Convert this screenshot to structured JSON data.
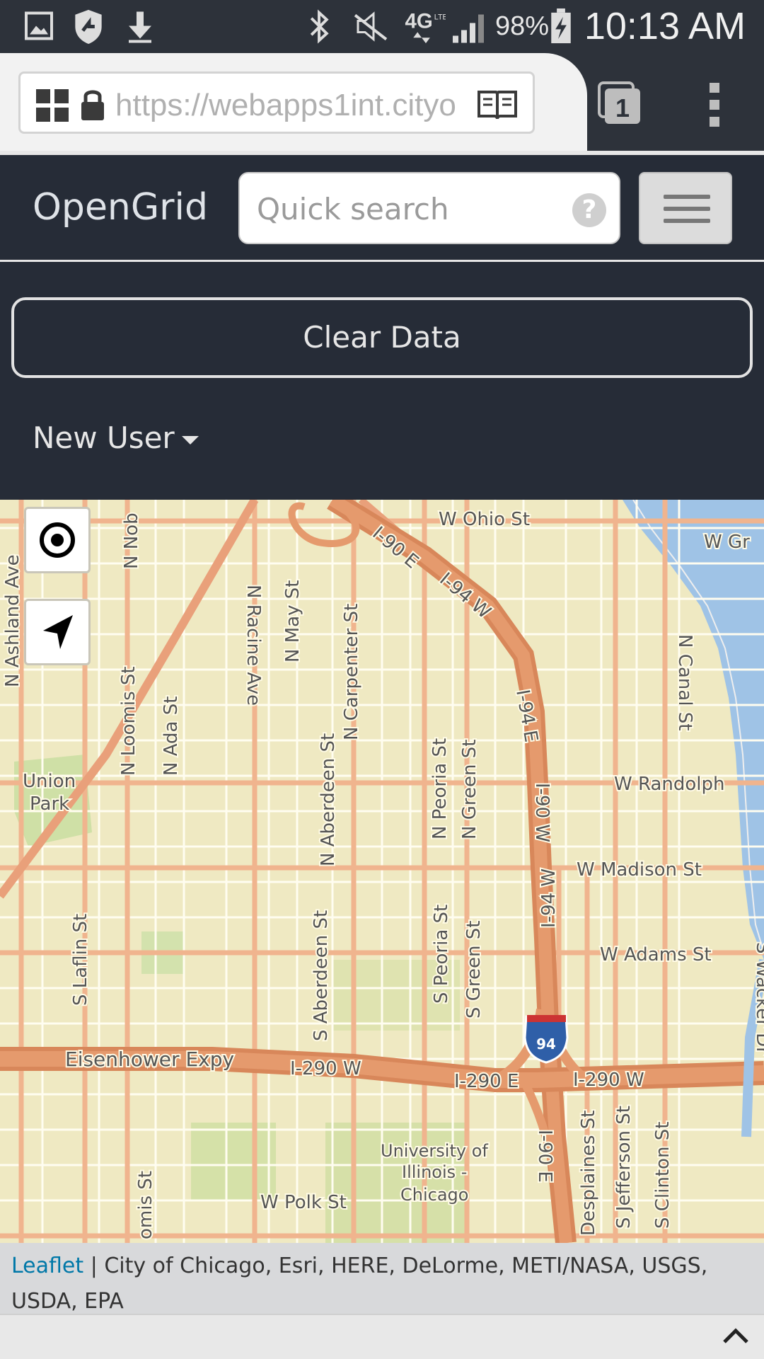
{
  "status_bar": {
    "battery": "98%",
    "time": "10:13 AM",
    "network": "4G"
  },
  "browser": {
    "url": "https://webapps1int.cityo",
    "tab_count": "1"
  },
  "app": {
    "brand": "OpenGrid",
    "search_placeholder": "Quick search",
    "help_glyph": "?",
    "clear_button": "Clear Data",
    "user_menu": "New User"
  },
  "map": {
    "streets": {
      "ohio": "W Ohio St",
      "gr": "W Gr",
      "randolph": "W Randolph",
      "madison": "W Madison St",
      "adams": "W Adams St",
      "polk": "W Polk St",
      "ashland": "N Ashland Ave",
      "nob": "N Nob",
      "may": "N May St",
      "carpenter": "N Carpenter St",
      "racine": "N Racine Ave",
      "loomis": "N Loomis St",
      "ada": "N Ada St",
      "n_aberdeen": "N Aberdeen St",
      "n_peoria": "N Peoria St",
      "n_green": "N Green St",
      "s_laflin": "S Laflin St",
      "s_aberdeen": "S Aberdeen St",
      "s_peoria": "S Peoria St",
      "s_green": "S Green St",
      "canal": "N Canal St",
      "desplaines": "Desplaines St",
      "jefferson": "S Jefferson St",
      "clinton": "S Clinton St",
      "wacker": "S Wacker Dr",
      "s_loomis": "omis St",
      "eisenhower": "Eisenhower Expy",
      "i290w_left": "I-290 W",
      "i290e": "I-290 E",
      "i290w_right": "I-290 W",
      "i90e_top": "I-90 E",
      "i94w_top": "I-94 W",
      "i94e": "I-94 E",
      "i90w": "I-90 W",
      "i94w_mid": "I-94 W",
      "i90e_bottom": "I-90 E",
      "shield": "94"
    },
    "places": {
      "union_park_1": "Union",
      "union_park_2": "Park",
      "uic_1": "University of",
      "uic_2": "Illinois -",
      "uic_3": "Chicago"
    },
    "attribution_link": "Leaflet",
    "attribution_text": " | City of Chicago, Esri, HERE, DeLorme, METI/NASA, USGS, USDA, EPA"
  },
  "colors": {
    "header_bg": "#262c37",
    "map_bg": "#efe9c2",
    "road": "#e9a07a",
    "highway": "#d8875a",
    "water": "#9fc3e6",
    "link": "#0078a8"
  }
}
